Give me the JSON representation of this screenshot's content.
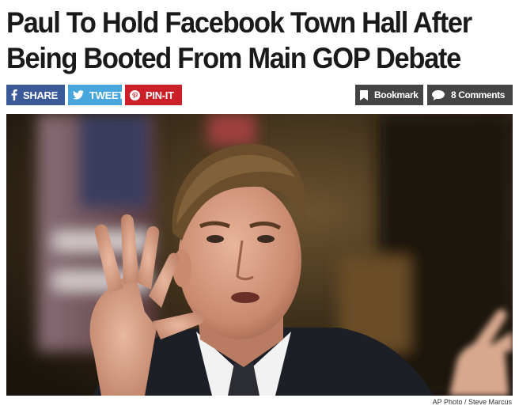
{
  "article": {
    "headline_line1": "Paul To Hold Facebook Town Hall After",
    "headline_line2": "Being Booted From Main GOP Debate",
    "photo_credit": "AP Photo / Steve Marcus"
  },
  "share": {
    "facebook_label": "SHARE",
    "twitter_label": "TWEET",
    "pinterest_label": "PIN-IT"
  },
  "actions": {
    "bookmark_label": "Bookmark",
    "comments_label": "8 Comments"
  },
  "colors": {
    "facebook": "#3b5998",
    "twitter": "#47a6dc",
    "pinterest": "#cb2027",
    "action_buttons": "#444444"
  },
  "icons": [
    "facebook-icon",
    "twitter-icon",
    "pinterest-icon",
    "bookmark-icon",
    "comment-icon"
  ]
}
